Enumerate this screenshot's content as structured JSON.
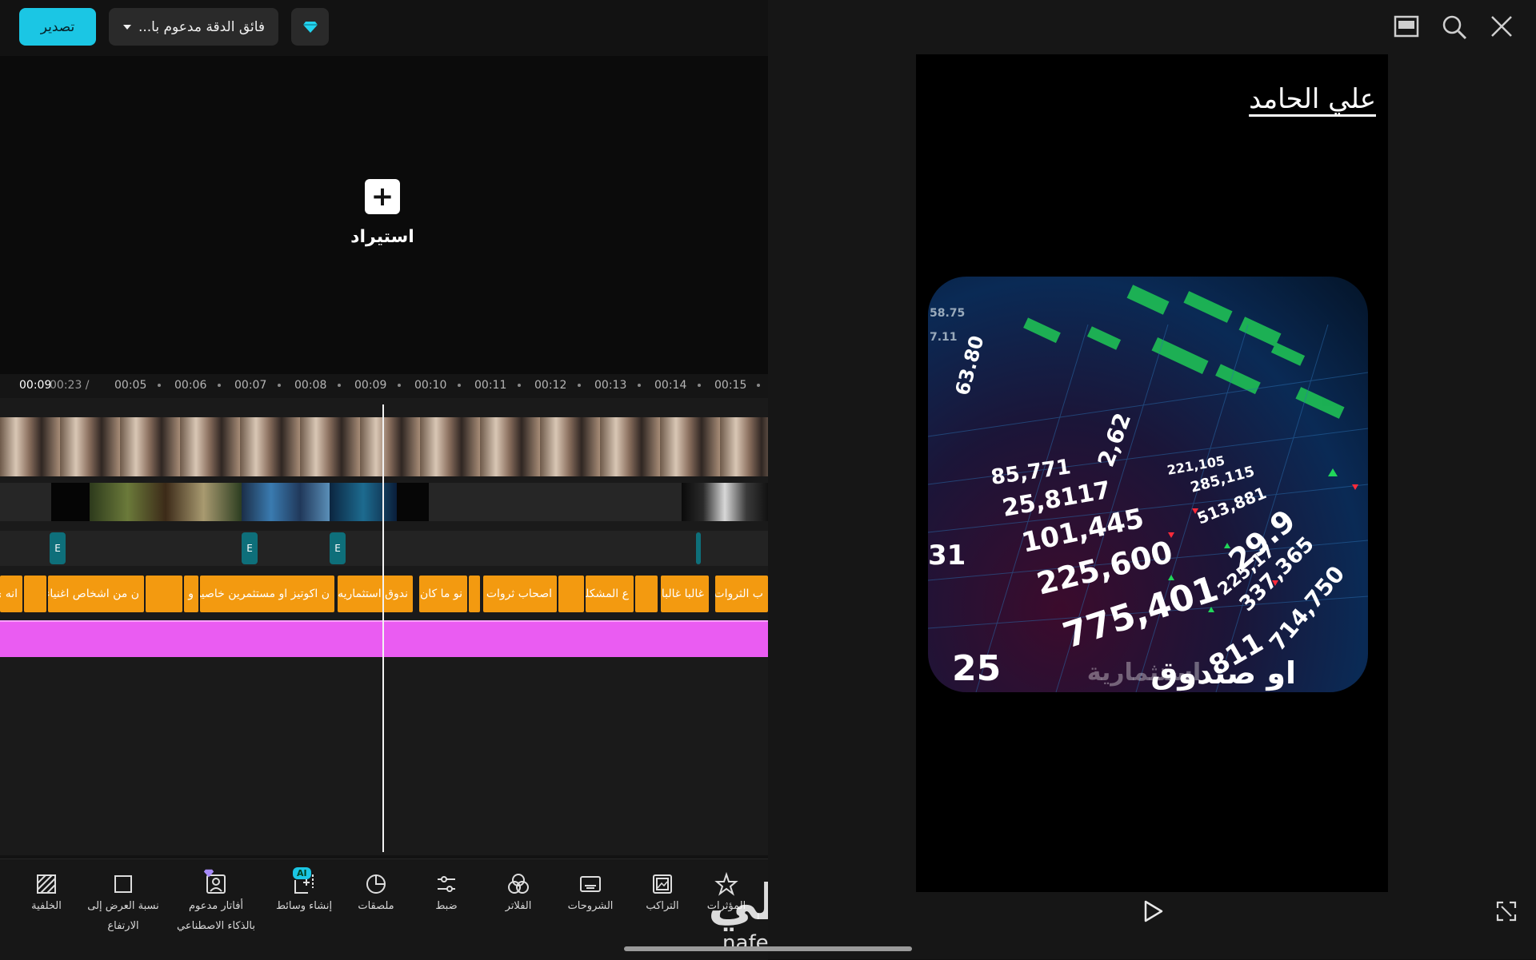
{
  "topbar": {
    "export_label": "تصدير",
    "resolution_label": "فائق الدقة مدعوم با...",
    "pro_icon": "diamond-icon"
  },
  "import": {
    "label": "استيراد"
  },
  "ruler": {
    "current_time": "00:09",
    "total_time": "00:23 /",
    "ticks": [
      "00:05",
      "00:06",
      "00:07",
      "00:08",
      "00:09",
      "00:10",
      "00:11",
      "00:12",
      "00:13",
      "00:14",
      "00:15"
    ]
  },
  "fx_label": "E",
  "subtitles": [
    "انه ي",
    "",
    "ن من اشخاص اغنياء",
    "",
    "و",
    "ن اكوتيز او مستثمرين خاصين",
    "ندوق استثماريه",
    "نو ما كان",
    "",
    "اصحاب ثروات",
    "",
    "ع المشكله",
    "",
    "غالبا غالبا",
    "ب الثروات"
  ],
  "toolbar": {
    "items": [
      {
        "label": "الخلفية",
        "icon": "background-icon"
      },
      {
        "label": "نسبة العرض إلى الارتفاع",
        "icon": "aspect-ratio-icon"
      },
      {
        "label": "أفاتار مدعوم بالذكاء الاصطناعي",
        "icon": "ai-avatar-icon"
      },
      {
        "label": "إنشاء وسائط",
        "icon": "create-media-icon",
        "badge": "AI"
      },
      {
        "label": "ملصقات",
        "icon": "sticker-icon"
      },
      {
        "label": "ضبط",
        "icon": "adjust-icon"
      },
      {
        "label": "الفلاتر",
        "icon": "filters-icon"
      },
      {
        "label": "الشروحات",
        "icon": "captions-icon"
      },
      {
        "label": "التراكب",
        "icon": "overlay-icon"
      },
      {
        "label": "المؤثرات",
        "icon": "effects-icon"
      }
    ]
  },
  "preview": {
    "watermark_name": "علي الحامد",
    "caption": "او صندوق",
    "caption_ghost": "استثمارية",
    "stock_numbers": [
      "85,771",
      "25,8117",
      "101,445",
      "225,600",
      "775,401",
      "811",
      "714,750",
      "337,365",
      "63.80",
      "2,62",
      "31",
      "25",
      "58.75",
      "7.11",
      "29.9",
      "225,17",
      "513,881",
      "285,115",
      "221,105"
    ]
  },
  "watermark_site": {
    "brand": "نفذلي",
    "url": "nafezly.com"
  },
  "colors": {
    "accent": "#1bc6e4",
    "subtitle_clip": "#f39a10",
    "audio_clip": "#ea5cf2",
    "fx_clip": "#0e6f7a"
  }
}
